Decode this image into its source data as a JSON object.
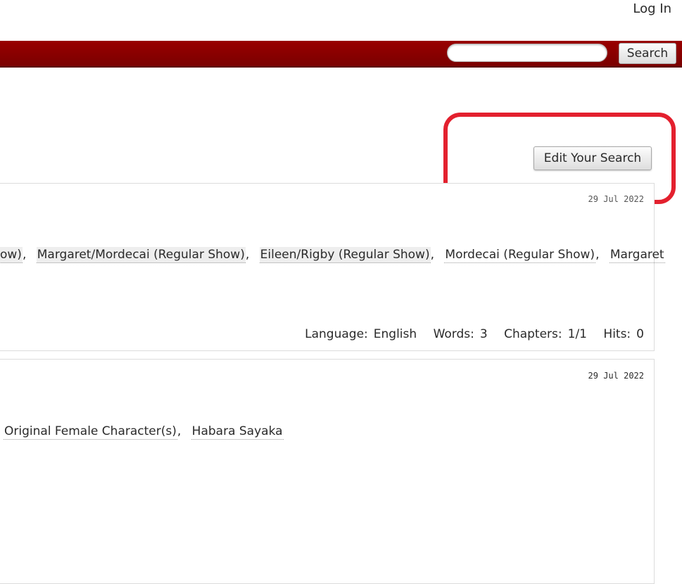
{
  "header": {
    "login_label": "Log In",
    "search": {
      "placeholder": "",
      "button_label": "Search"
    },
    "accent_color": "#900000"
  },
  "page": {
    "edit_search_label": "Edit Your Search",
    "highlight_color": "#e3202e"
  },
  "works": [
    {
      "date": "29 Jul 2022",
      "tags": [
        {
          "text": "ow)",
          "type": "relationship"
        },
        {
          "text": "Margaret/Mordecai (Regular Show)",
          "type": "relationship"
        },
        {
          "text": "Eileen/Rigby (Regular Show)",
          "type": "relationship"
        },
        {
          "text": "Mordecai (Regular Show)",
          "type": "character"
        },
        {
          "text": "Margaret",
          "type": "character"
        }
      ],
      "stats": {
        "language_label": "Language:",
        "language": "English",
        "words_label": "Words:",
        "words": "3",
        "chapters_label": "Chapters:",
        "chapters": "1/1",
        "hits_label": "Hits:",
        "hits": "0"
      }
    },
    {
      "date": "29 Jul 2022",
      "tags": [
        {
          "text": "Original Female Character(s)",
          "type": "character"
        },
        {
          "text": "Habara Sayaka",
          "type": "character"
        }
      ]
    }
  ]
}
